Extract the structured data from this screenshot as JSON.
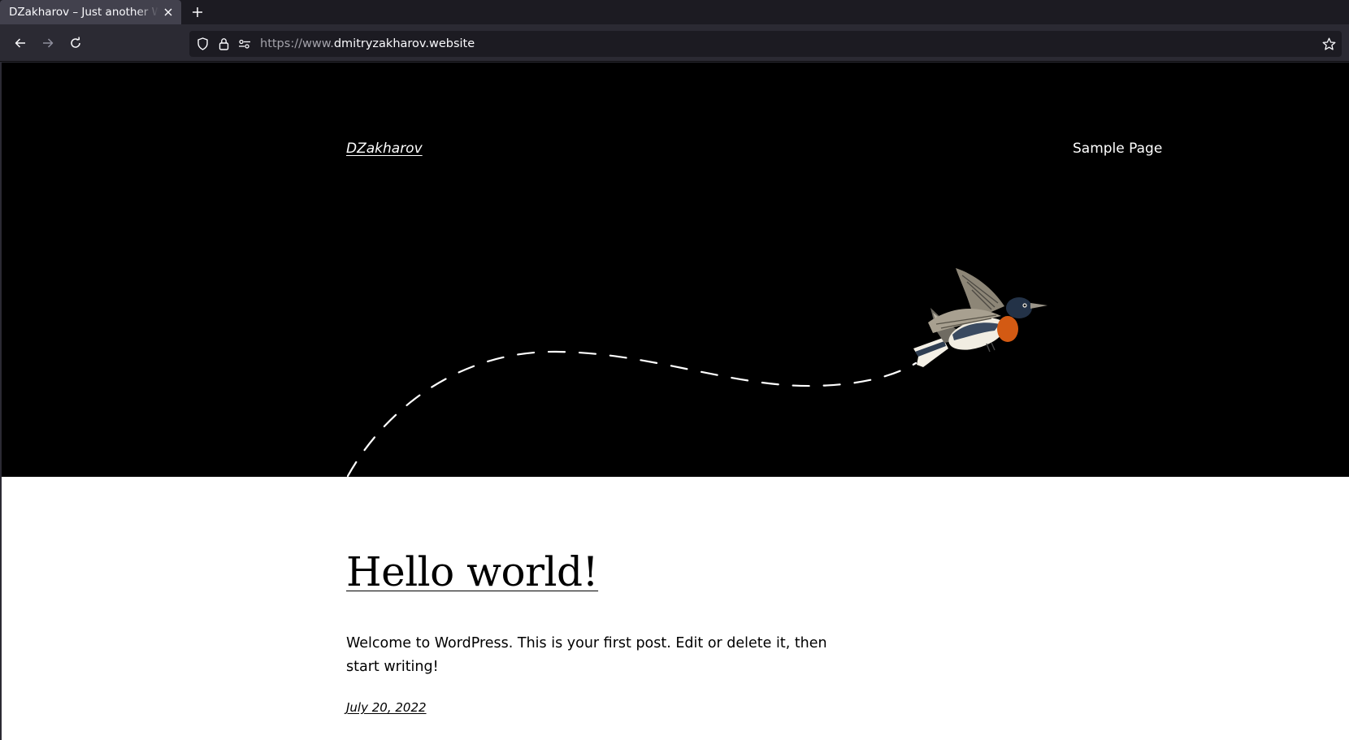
{
  "browser": {
    "tab_title": "DZakharov – Just another WordPress site",
    "url_scheme": "https://www.",
    "url_host": "dmitryzakharov.website"
  },
  "site": {
    "title": "DZakharov",
    "nav": [
      {
        "label": "Sample Page"
      }
    ]
  },
  "post": {
    "title": "Hello world!",
    "excerpt": "Welcome to WordPress. This is your first post. Edit or delete it, then start writing!",
    "date": "July 20, 2022"
  },
  "colors": {
    "hero_background": "#000000",
    "page_background": "#ffffff",
    "chrome_background": "#2b2a33",
    "tab_active": "#42414d",
    "urlbar_background": "#1c1b22"
  },
  "icons": {
    "tab_close": "close-icon",
    "new_tab": "plus-icon",
    "back": "arrow-left-icon",
    "forward": "arrow-right-icon",
    "reload": "reload-icon",
    "tracking_protection": "shield-icon",
    "secure": "lock-icon",
    "permissions": "permissions-icon",
    "bookmark": "star-icon",
    "hero": "bird-illustration"
  }
}
